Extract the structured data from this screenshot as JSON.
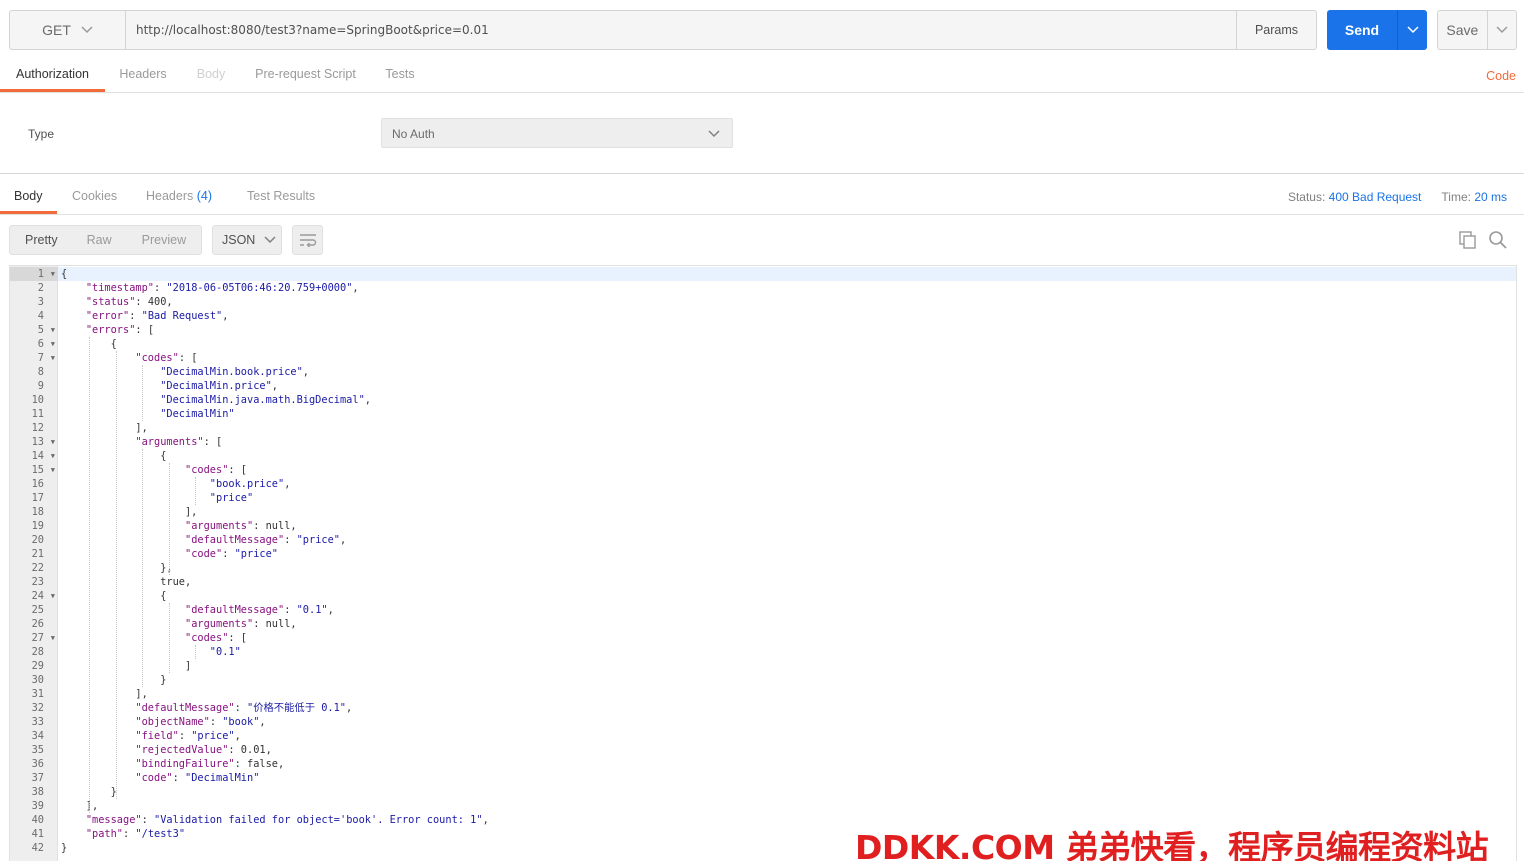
{
  "request": {
    "method": "GET",
    "url": "http://localhost:8080/test3?name=SpringBoot&price=0.01",
    "params_label": "Params",
    "send_label": "Send",
    "save_label": "Save"
  },
  "request_tabs": [
    "Authorization",
    "Headers",
    "Body",
    "Pre-request Script",
    "Tests"
  ],
  "code_link": "Code",
  "auth": {
    "type_label": "Type",
    "type_value": "No Auth"
  },
  "response_tabs": {
    "body": "Body",
    "cookies": "Cookies",
    "headers": "Headers",
    "headers_count": "(4)",
    "test_results": "Test Results"
  },
  "status": {
    "status_label": "Status:",
    "status_value": "400 Bad Request",
    "time_label": "Time:",
    "time_value": "20 ms"
  },
  "view_modes": [
    "Pretty",
    "Raw",
    "Preview"
  ],
  "format": "JSON",
  "code_lines": [
    "{",
    "    \"timestamp\": \"2018-06-05T06:46:20.759+0000\",",
    "    \"status\": 400,",
    "    \"error\": \"Bad Request\",",
    "    \"errors\": [",
    "        {",
    "            \"codes\": [",
    "                \"DecimalMin.book.price\",",
    "                \"DecimalMin.price\",",
    "                \"DecimalMin.java.math.BigDecimal\",",
    "                \"DecimalMin\"",
    "            ],",
    "            \"arguments\": [",
    "                {",
    "                    \"codes\": [",
    "                        \"book.price\",",
    "                        \"price\"",
    "                    ],",
    "                    \"arguments\": null,",
    "                    \"defaultMessage\": \"price\",",
    "                    \"code\": \"price\"",
    "                },",
    "                true,",
    "                {",
    "                    \"defaultMessage\": \"0.1\",",
    "                    \"arguments\": null,",
    "                    \"codes\": [",
    "                        \"0.1\"",
    "                    ]",
    "                }",
    "            ],",
    "            \"defaultMessage\": \"价格不能低于 0.1\",",
    "            \"objectName\": \"book\",",
    "            \"field\": \"price\",",
    "            \"rejectedValue\": 0.01,",
    "            \"bindingFailure\": false,",
    "            \"code\": \"DecimalMin\"",
    "        }",
    "    ],",
    "    \"message\": \"Validation failed for object='book'. Error count: 1\",",
    "    \"path\": \"/test3\"",
    "}"
  ],
  "foldable_lines": [
    1,
    5,
    6,
    7,
    13,
    14,
    15,
    24,
    27
  ],
  "watermark": "DDKK.COM 弟弟快看，程序员编程资料站",
  "colors": {
    "accent": "#f26b3a",
    "send": "#1a73e8",
    "json_key": "#881280",
    "json_string": "#1a1aa6"
  }
}
